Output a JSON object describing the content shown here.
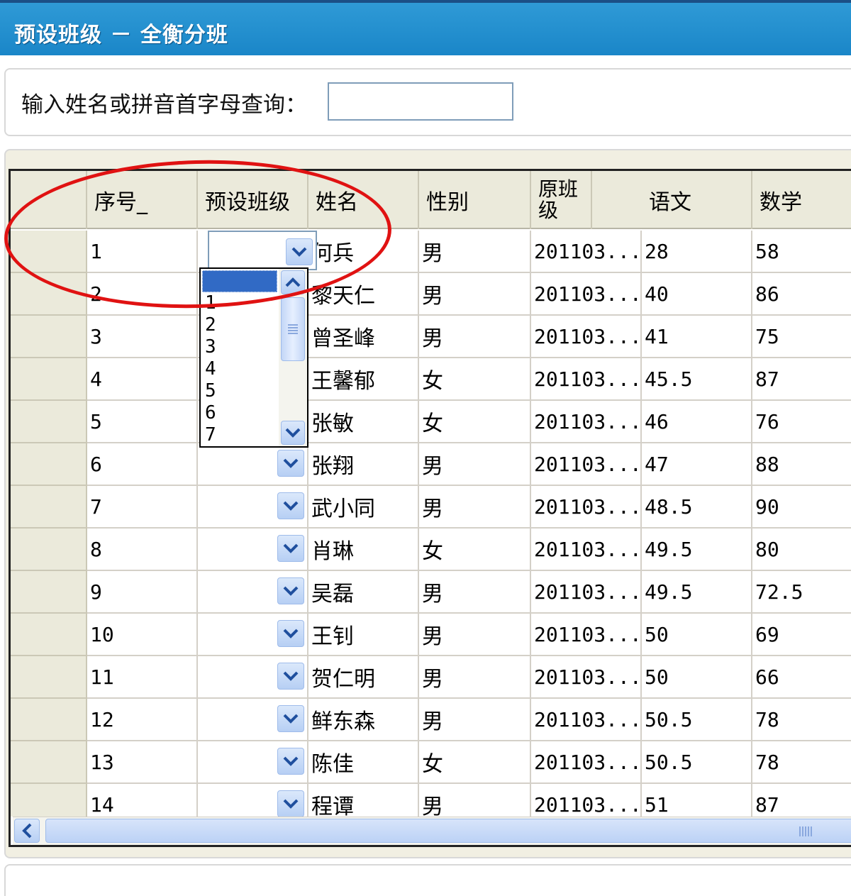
{
  "window": {
    "title": "预设班级 － 全衡分班"
  },
  "search": {
    "label": "输入姓名或拼音首字母查询：",
    "value": "",
    "placeholder": ""
  },
  "grid": {
    "columns": [
      "序号_",
      "预设班级",
      "姓名",
      "性别",
      "原班级",
      "语文",
      "数学"
    ],
    "rows": [
      {
        "seq": "1",
        "preset": "",
        "name": "何兵",
        "gender": "男",
        "orig_class": "201103...",
        "chinese": "28",
        "math": "58"
      },
      {
        "seq": "2",
        "preset": "",
        "name": "黎天仁",
        "gender": "男",
        "orig_class": "201103...",
        "chinese": "40",
        "math": "86"
      },
      {
        "seq": "3",
        "preset": "",
        "name": "曾圣峰",
        "gender": "男",
        "orig_class": "201103...",
        "chinese": "41",
        "math": "75"
      },
      {
        "seq": "4",
        "preset": "",
        "name": "王馨郁",
        "gender": "女",
        "orig_class": "201103...",
        "chinese": "45.5",
        "math": "87"
      },
      {
        "seq": "5",
        "preset": "",
        "name": "张敏",
        "gender": "女",
        "orig_class": "201103...",
        "chinese": "46",
        "math": "76"
      },
      {
        "seq": "6",
        "preset": "",
        "name": "张翔",
        "gender": "男",
        "orig_class": "201103...",
        "chinese": "47",
        "math": "88"
      },
      {
        "seq": "7",
        "preset": "",
        "name": "武小同",
        "gender": "男",
        "orig_class": "201103...",
        "chinese": "48.5",
        "math": "90"
      },
      {
        "seq": "8",
        "preset": "",
        "name": "肖琳",
        "gender": "女",
        "orig_class": "201103...",
        "chinese": "49.5",
        "math": "80"
      },
      {
        "seq": "9",
        "preset": "",
        "name": "吴磊",
        "gender": "男",
        "orig_class": "201103...",
        "chinese": "49.5",
        "math": "72.5"
      },
      {
        "seq": "10",
        "preset": "",
        "name": "王钊",
        "gender": "男",
        "orig_class": "201103...",
        "chinese": "50",
        "math": "69"
      },
      {
        "seq": "11",
        "preset": "",
        "name": "贺仁明",
        "gender": "男",
        "orig_class": "201103...",
        "chinese": "50",
        "math": "66"
      },
      {
        "seq": "12",
        "preset": "",
        "name": "鲜东森",
        "gender": "男",
        "orig_class": "201103...",
        "chinese": "50.5",
        "math": "78"
      },
      {
        "seq": "13",
        "preset": "",
        "name": "陈佳",
        "gender": "女",
        "orig_class": "201103...",
        "chinese": "50.5",
        "math": "78"
      },
      {
        "seq": "14",
        "preset": "",
        "name": "程谭",
        "gender": "男",
        "orig_class": "201103...",
        "chinese": "51",
        "math": "87"
      }
    ]
  },
  "preset_dropdown": {
    "options": [
      "",
      "1",
      "2",
      "3",
      "4",
      "5",
      "6",
      "7"
    ],
    "selected_index": 0
  },
  "icons": {
    "dropdown": "chevron-down-icon",
    "scroll_up": "chevron-up-icon",
    "scroll_left": "chevron-left-icon",
    "row_pointer": "current-row-icon"
  },
  "colors": {
    "title_bar": "#1a86c8",
    "selection": "#316ac5",
    "annotation": "#e01212",
    "header_bg": "#ebeadb"
  }
}
